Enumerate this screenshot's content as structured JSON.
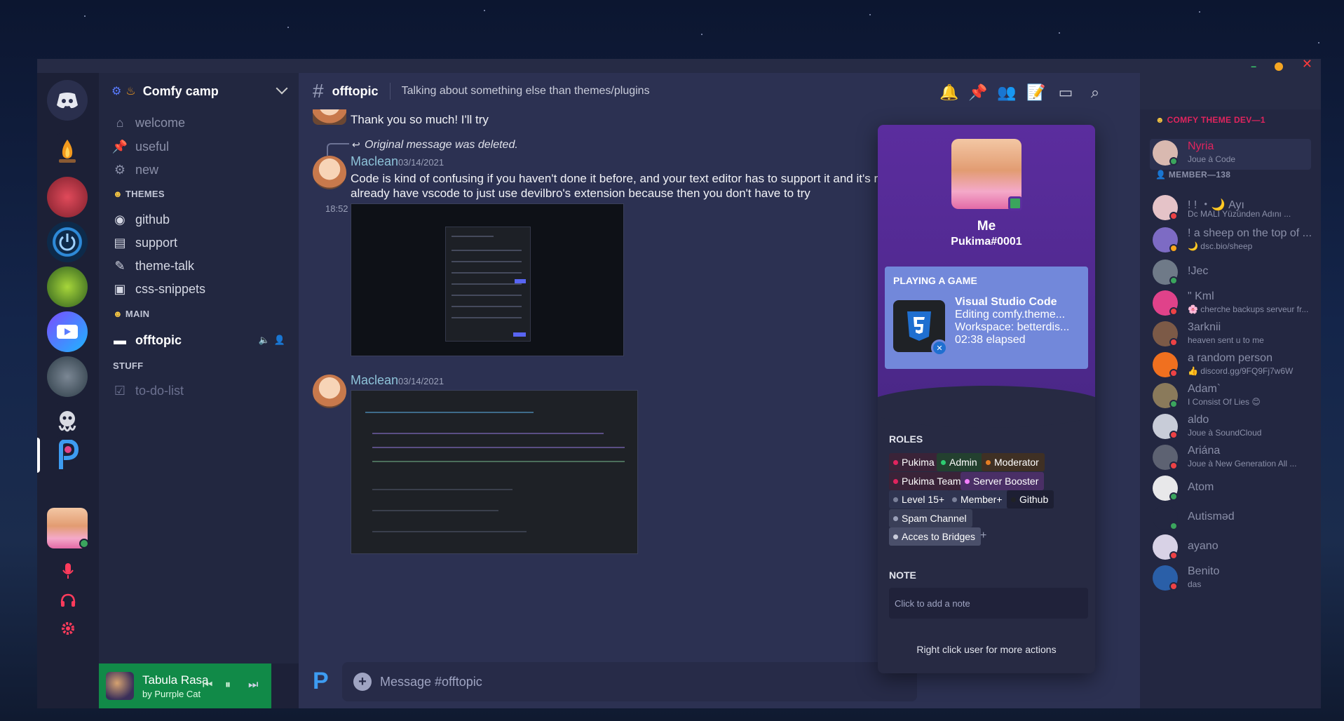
{
  "colors": {
    "accent_green": "#118a48",
    "blurple": "#7288da",
    "online": "#3ba55d",
    "dnd": "#ed4245",
    "popout_banner": "#5b2d9e"
  },
  "window_controls": {
    "minimize": "–",
    "close": "✕"
  },
  "server": {
    "name": "Comfy camp",
    "icons": [
      "gear-icon",
      "fire-icon"
    ]
  },
  "channels": {
    "top": [
      {
        "icon": "home-icon",
        "label": "welcome"
      },
      {
        "icon": "pin-icon",
        "label": "useful"
      },
      {
        "icon": "gear-icon",
        "label": "new"
      }
    ],
    "categories": {
      "themes": "THEMES",
      "main": "MAIN",
      "stuff": "STUFF"
    },
    "themes": [
      {
        "icon": "github-icon",
        "label": "github"
      },
      {
        "icon": "text-channel-icon",
        "label": "support"
      },
      {
        "icon": "brush-icon",
        "label": "theme-talk"
      },
      {
        "icon": "css-icon",
        "label": "css-snippets"
      }
    ],
    "main": [
      {
        "icon": "chat-icon",
        "label": "offtopic",
        "active": true
      }
    ],
    "stuff": [
      {
        "icon": "checkbox-icon",
        "label": "to-do-list"
      }
    ]
  },
  "player": {
    "track": "Tabula Rasa",
    "artist": "by Purrple Cat"
  },
  "chat": {
    "channel": "offtopic",
    "topic": "Talking about something else than themes/plugins",
    "messages": {
      "prev_text": "Thank you so much! I'll try",
      "deleted_note": "Original message was deleted.",
      "m1_author": "Maclean",
      "m1_date": "03/14/2021",
      "m1_line1": "Code is kind of confusing if you haven't done it before, and your text editor has to support it and it's recommended to",
      "m1_line2": "already have vscode to just use devilbro's extension because then you don't have to try",
      "m1_time": "18:52",
      "m2_author": "Maclean",
      "m2_date": "03/14/2021"
    },
    "composer_placeholder": "Message #offtopic"
  },
  "popout": {
    "display_name": "Me",
    "tag": "Pukima#0001",
    "activity_heading": "PLAYING A GAME",
    "activity_lines": [
      "Visual Studio Code",
      "Editing comfy.theme...",
      "Workspace: betterdis...",
      "02:38 elapsed"
    ],
    "roles_heading": "ROLES",
    "roles": [
      {
        "name": "Pukima",
        "color": "#e0245e"
      },
      {
        "name": "Admin",
        "color": "#2ecc71"
      },
      {
        "name": "Moderator",
        "color": "#e67e22"
      },
      {
        "name": "Pukima Team",
        "color": "#e0245e"
      },
      {
        "name": "Server Booster",
        "color": "#f47fff"
      },
      {
        "name": "Level 15+",
        "color": "#7a8099"
      },
      {
        "name": "Member+",
        "color": "#7a8099"
      },
      {
        "name": "Github",
        "color": "#202225"
      },
      {
        "name": "Spam Channel",
        "color": "#9aa0b8"
      },
      {
        "name": "Acces to Bridges",
        "color": "#c9ccda"
      }
    ],
    "add_role": "+",
    "note_heading": "NOTE",
    "note_placeholder": "Click to add a note",
    "footer": "Right click user for more actions"
  },
  "members": {
    "cat1": "COMFY THEME DEV—1",
    "cat2": "MEMBER—138",
    "list": [
      {
        "name": "Nyria",
        "sub": "Joue à Code",
        "color": "#e0245e",
        "status": "#3ba55d",
        "av": "#d9b9b0"
      },
      {
        "name": "! ! ・🌙 Ayı",
        "sub": "Dc MALI Yüzünden Adını ...",
        "color": "#8a8fa8",
        "status": "#ed4245",
        "av": "#e5c3c8"
      },
      {
        "name": "! a sheep on the top of ...",
        "sub": "🌙 dsc.bio/sheep",
        "color": "#8a8fa8",
        "status": "#faa61a",
        "av": "#7d6bc4"
      },
      {
        "name": "!Jec",
        "sub": "",
        "color": "#8a8fa8",
        "status": "#3ba55d",
        "av": "#6f7a88"
      },
      {
        "name": "\" Kml",
        "sub": "🌸 cherche backups serveur fr...",
        "color": "#8a8fa8",
        "status": "#ed4245",
        "av": "#e0428a"
      },
      {
        "name": "3arknii",
        "sub": "heaven sent u to me",
        "color": "#8a8fa8",
        "status": "#ed4245",
        "av": "#7c5a47"
      },
      {
        "name": "a random person",
        "sub": "👍 discord.gg/9FQ9Fj7w6W",
        "color": "#8a8fa8",
        "status": "#ed4245",
        "av": "#f0701f"
      },
      {
        "name": "Adam`",
        "sub": "I Consist Of Lies 😊",
        "color": "#8a8fa8",
        "status": "#3ba55d",
        "av": "#8a7a5b"
      },
      {
        "name": "aldo",
        "sub": "Joue à SoundCloud",
        "color": "#8a8fa8",
        "status": "#ed4245",
        "av": "#c8ccd8"
      },
      {
        "name": "Ariána",
        "sub": "Joue à New Generation All ...",
        "color": "#8a8fa8",
        "status": "#ed4245",
        "av": "#5d6272"
      },
      {
        "name": "Atom",
        "sub": "",
        "color": "#8a8fa8",
        "status": "#3ba55d",
        "av": "#e8e8ea"
      },
      {
        "name": "Autisməd",
        "sub": "",
        "color": "#8a8fa8",
        "status": "#3ba55d",
        "av": "#232741"
      },
      {
        "name": "ayano",
        "sub": "",
        "color": "#8a8fa8",
        "status": "#ed4245",
        "av": "#d8d2e6"
      },
      {
        "name": "Benito",
        "sub": "das",
        "color": "#8a8fa8",
        "status": "#ed4245",
        "av": "#2a5fa8"
      }
    ]
  }
}
